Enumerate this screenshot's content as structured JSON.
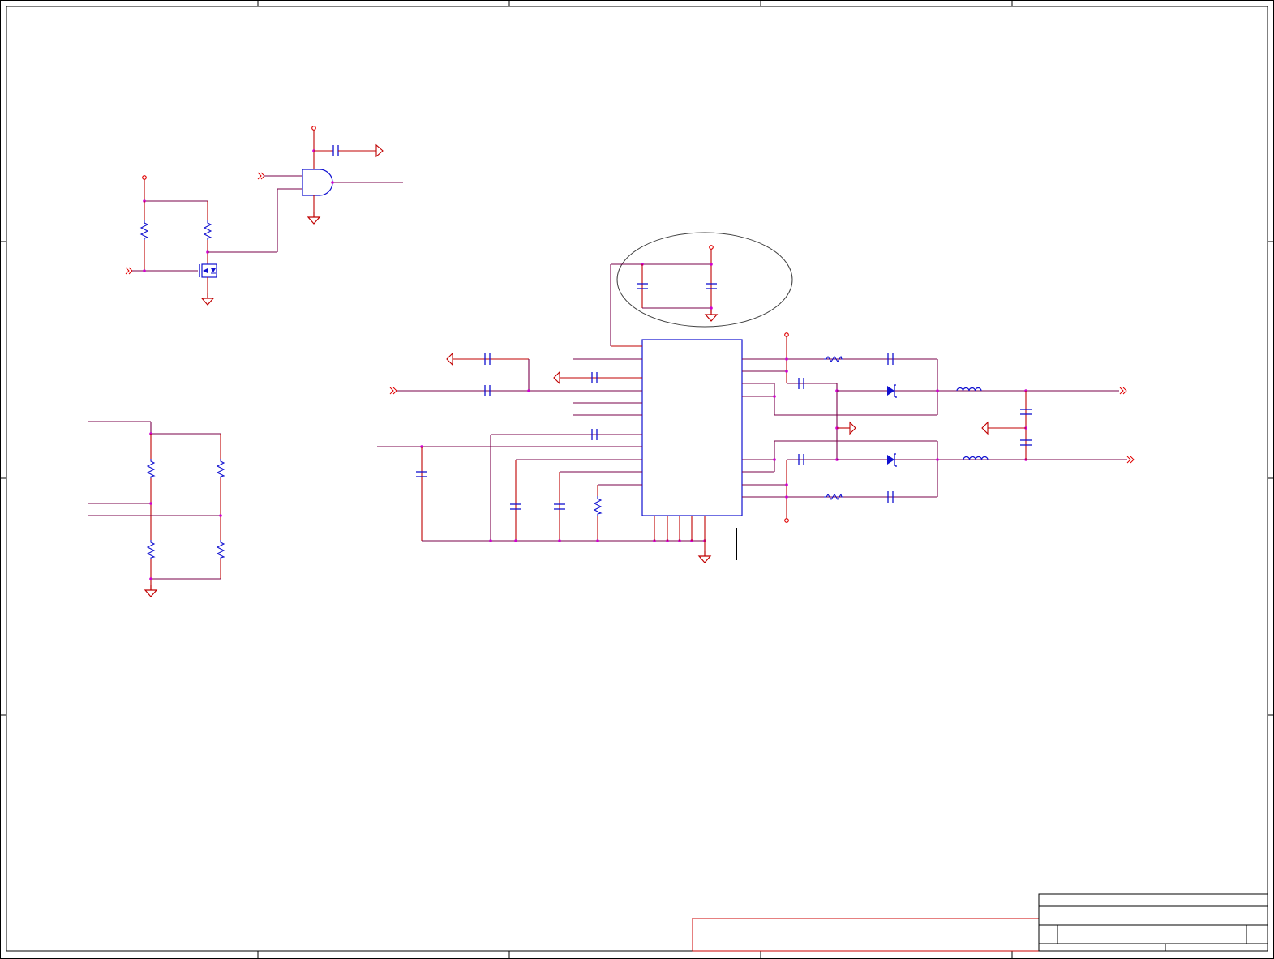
{
  "sheet": {
    "description_visible_text": [],
    "colors": {
      "wire": "#c00000",
      "wire_dark": "#7a004a",
      "component": "#1010d0",
      "junction": "#d000d0",
      "power_pin": "#e00000",
      "frame": "#000000",
      "title_block": "#cc0000",
      "annotation_ellipse": "#404040"
    },
    "icons": [
      "ground-symbol",
      "power-port-symbol",
      "offpage-connector-symbol",
      "capacitor-symbol",
      "resistor-symbol",
      "inductor-symbol",
      "diode-symbol",
      "mosfet-symbol",
      "and-gate-symbol",
      "ic-block-symbol"
    ]
  }
}
